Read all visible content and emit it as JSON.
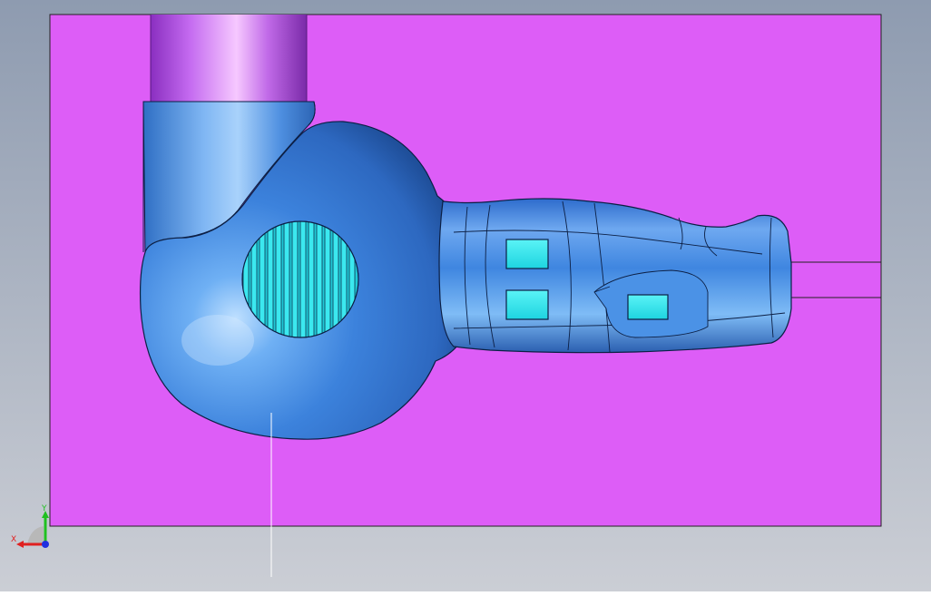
{
  "viewport": {
    "background_top": "#8f9cb0",
    "background_bottom": "#c9ccd3",
    "mold_plate_color": "#dc5cf6",
    "part_color": "#3d86e0",
    "insert_color": "#2ee6ee",
    "pipe_color": "#b752e8"
  },
  "triad": {
    "x_label": "X",
    "y_label": "Y",
    "x_color": "#e02020",
    "y_color": "#20c020",
    "z_color": "#2030e0"
  }
}
